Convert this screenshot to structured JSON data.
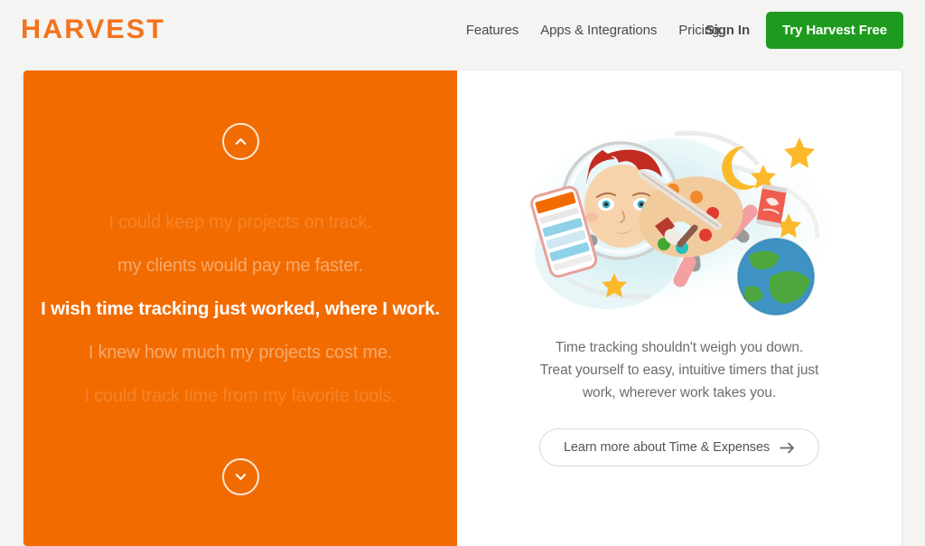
{
  "colors": {
    "brand_orange": "#f26b00",
    "logo_orange": "#f3721c",
    "cta_green": "#1e9b1e",
    "page_bg": "#f4f4f2",
    "text_gray": "#4b4b4b",
    "body_gray": "#6d6d6d"
  },
  "header": {
    "logo": "HARVEST",
    "nav": [
      {
        "label": "Features"
      },
      {
        "label": "Apps & Integrations"
      },
      {
        "label": "Pricing"
      }
    ],
    "sign_in": "Sign In",
    "cta": "Try Harvest Free"
  },
  "hero": {
    "carousel": {
      "prev_icon": "chevron-up-icon",
      "next_icon": "chevron-down-icon",
      "slides": [
        {
          "text": "I could keep my projects on track.",
          "state": "far"
        },
        {
          "text": "my clients would pay me faster.",
          "state": "near"
        },
        {
          "text": "I wish time tracking just worked, where I work.",
          "state": "active"
        },
        {
          "text": "I knew how much my projects cost me.",
          "state": "near"
        },
        {
          "text": "I could track time from my favorite tools.",
          "state": "far"
        }
      ]
    },
    "panel": {
      "illustration_alt": "astronaut-with-phone-and-paint-palette-illustration",
      "blurb_line_1": "Time tracking shouldn't weigh you down.",
      "blurb_line_2": "Treat yourself to easy, intuitive timers that just",
      "blurb_line_3": "work, wherever work takes you.",
      "learn_more": "Learn more about Time & Expenses",
      "learn_more_icon": "arrow-right-icon"
    }
  }
}
